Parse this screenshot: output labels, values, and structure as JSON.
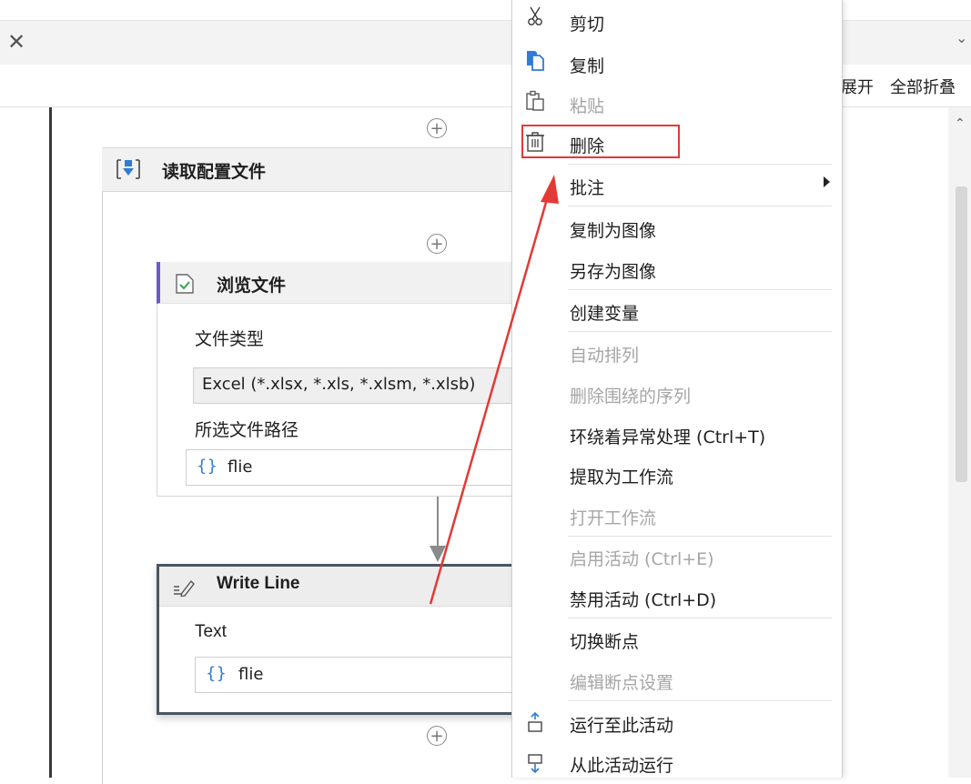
{
  "toolbar": {
    "expand_all": "展开",
    "collapse_all": "全部折叠"
  },
  "sequence": {
    "title": "读取配置文件"
  },
  "browse_file": {
    "title": "浏览文件",
    "file_type_label": "文件类型",
    "file_type_value": "Excel (*.xlsx, *.xls, *.xlsm, *.xlsb)",
    "path_label": "所选文件路径",
    "path_brace": "{}",
    "path_value": "flie"
  },
  "write_line": {
    "title": "Write Line",
    "text_label": "Text",
    "text_brace": "{}",
    "text_value": "flie"
  },
  "context_menu": {
    "items": [
      {
        "label": "剪切",
        "enabled": true,
        "icon": "scissors-icon"
      },
      {
        "label": "复制",
        "enabled": true,
        "icon": "copy-icon"
      },
      {
        "label": "粘贴",
        "enabled": false,
        "icon": "paste-icon"
      },
      {
        "label": "删除",
        "enabled": true,
        "icon": "trash-icon"
      },
      {
        "label": "批注",
        "enabled": true,
        "submenu": true
      },
      {
        "label": "复制为图像",
        "enabled": true
      },
      {
        "label": "另存为图像",
        "enabled": true
      },
      {
        "label": "创建变量",
        "enabled": true
      },
      {
        "label": "自动排列",
        "enabled": false
      },
      {
        "label": "删除围绕的序列",
        "enabled": false
      },
      {
        "label": "环绕着异常处理 (Ctrl+T)",
        "enabled": true
      },
      {
        "label": "提取为工作流",
        "enabled": true
      },
      {
        "label": "打开工作流",
        "enabled": false
      },
      {
        "label": "启用活动 (Ctrl+E)",
        "enabled": false
      },
      {
        "label": "禁用活动 (Ctrl+D)",
        "enabled": true
      },
      {
        "label": "切换断点",
        "enabled": true
      },
      {
        "label": "编辑断点设置",
        "enabled": false
      },
      {
        "label": "运行至此活动",
        "enabled": true,
        "icon": "run-to-here-icon"
      },
      {
        "label": "从此活动运行",
        "enabled": true,
        "icon": "run-from-here-icon"
      }
    ]
  },
  "colors": {
    "highlight": "#e53935",
    "accent_blue": "#2f7bd6",
    "disabled_text": "#a6a6a6"
  }
}
